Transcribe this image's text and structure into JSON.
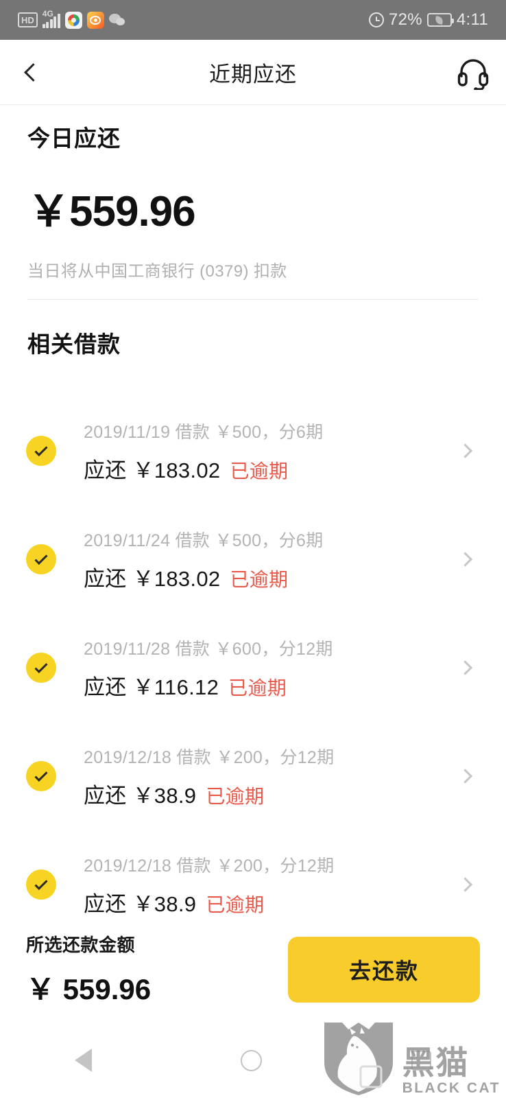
{
  "status_bar": {
    "hd_label": "HD",
    "network_label": "4G",
    "battery_percent": "72%",
    "time": "4:11",
    "icons": [
      "hd-icon",
      "signal-icon",
      "browser-app-icon",
      "weibo-app-icon",
      "wechat-app-icon",
      "alarm-icon",
      "battery-saver-icon"
    ]
  },
  "header": {
    "title": "近期应还",
    "back_icon": "chevron-left-icon",
    "support_icon": "headset-icon"
  },
  "today": {
    "label": "今日应还",
    "amount": "￥559.96",
    "note": "当日将从中国工商银行 (0379) 扣款"
  },
  "loans": {
    "heading": "相关借款",
    "items": [
      {
        "meta": "2019/11/19 借款 ￥500，分6期",
        "due": "应还 ￥183.02",
        "status": "已逾期",
        "checked": true
      },
      {
        "meta": "2019/11/24 借款 ￥500，分6期",
        "due": "应还 ￥183.02",
        "status": "已逾期",
        "checked": true
      },
      {
        "meta": "2019/11/28 借款 ￥600，分12期",
        "due": "应还 ￥116.12",
        "status": "已逾期",
        "checked": true
      },
      {
        "meta": "2019/12/18 借款 ￥200，分12期",
        "due": "应还 ￥38.9",
        "status": "已逾期",
        "checked": true
      },
      {
        "meta": "2019/12/18 借款 ￥200，分12期",
        "due": "应还 ￥38.9",
        "status": "已逾期",
        "checked": true
      }
    ]
  },
  "bottom": {
    "selected_label": "所选还款金额",
    "selected_amount": "￥ 559.96",
    "repay_button": "去还款"
  },
  "nav": {
    "back_icon": "triangle-back-icon",
    "home_icon": "circle-home-icon",
    "recents_icon": "square-recents-icon"
  },
  "watermark": {
    "cn": "黑猫",
    "en": "BLACK CAT",
    "logo_icon": "black-cat-shield-icon"
  },
  "colors": {
    "status_bar_bg": "#757575",
    "accent_yellow": "#f7d423",
    "button_yellow": "#f8cd2b",
    "overdue_red": "#e8594a",
    "muted_gray": "#b3b3b3"
  }
}
